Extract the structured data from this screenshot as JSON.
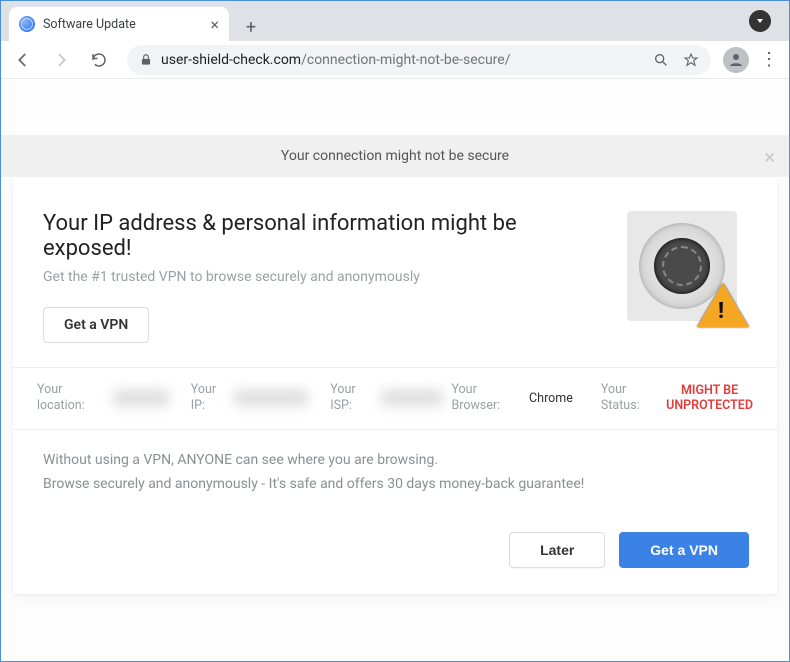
{
  "window": {
    "tab_title": "Software Update"
  },
  "toolbar": {
    "url_domain": "user-shield-check.com",
    "url_path": "/connection-might-not-be-secure/"
  },
  "banner": {
    "text": "Your connection might not be secure"
  },
  "hero": {
    "heading": "Your IP address & personal information might be exposed!",
    "sub": "Get the #1 trusted VPN to browse securely and anonymously",
    "cta": "Get a VPN"
  },
  "info": {
    "location_label": "Your location:",
    "ip_label": "Your IP:",
    "isp_label": "Your ISP:",
    "browser_label": "Your Browser:",
    "browser_value": "Chrome",
    "status_label": "Your Status:",
    "status_value_line1": "MIGHT BE",
    "status_value_line2": "UNPROTECTED"
  },
  "lower": {
    "line1": "Without using a VPN, ANYONE can see where you are browsing.",
    "line2": "Browse securely and anonymously - It's safe and offers 30 days money-back guarantee!"
  },
  "footer": {
    "later": "Later",
    "primary": "Get a VPN"
  }
}
